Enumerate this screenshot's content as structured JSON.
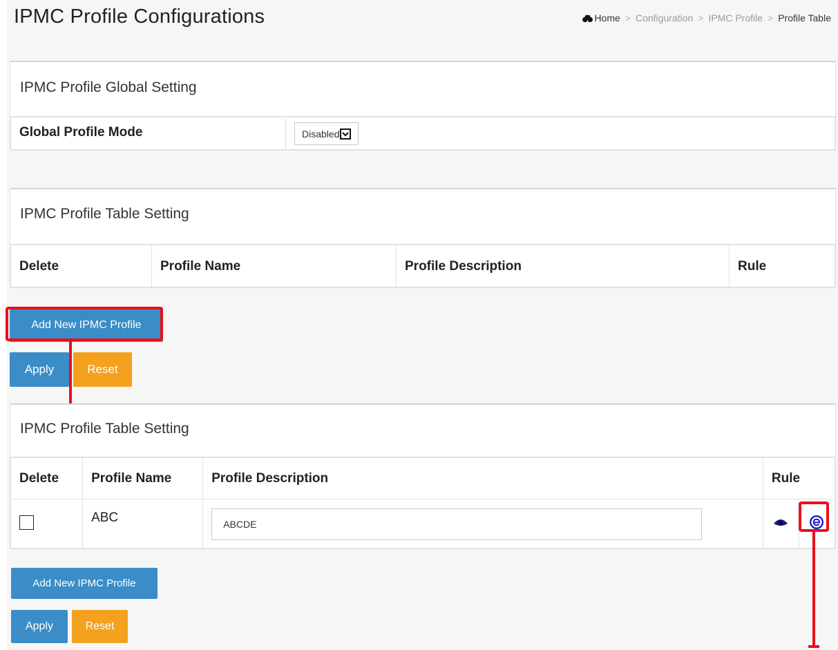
{
  "page": {
    "title": "IPMC Profile Configurations",
    "breadcrumb": [
      "Home",
      "Configuration",
      "IPMC Profile",
      "Profile Table"
    ],
    "breadcrumb_separator": ">"
  },
  "global_panel": {
    "heading": "IPMC Profile Global Setting",
    "mode_label": "Global Profile Mode",
    "mode_value": "Disabled"
  },
  "table_panel_before": {
    "heading": "IPMC Profile Table Setting",
    "columns": [
      "Delete",
      "Profile Name",
      "Profile Description",
      "Rule"
    ],
    "add_button": "Add New IPMC Profile",
    "apply_button": "Apply",
    "reset_button": "Reset"
  },
  "table_panel_after": {
    "heading": "IPMC Profile Table Setting",
    "columns": [
      "Delete",
      "Profile Name",
      "Profile Description",
      "Rule"
    ],
    "rows": [
      {
        "delete_checked": false,
        "profile_name": "ABC",
        "profile_description": "ABCDE"
      }
    ],
    "add_button": "Add New IPMC Profile",
    "apply_button": "Apply",
    "reset_button": "Reset"
  },
  "colors": {
    "primary": "#3a8dc6",
    "warning": "#f4a11e",
    "annotation": "#e8101a",
    "icon_blue": "#1a1acc"
  },
  "icons": [
    "home-icon",
    "view-rule-icon",
    "edit-rule-icon",
    "chevron-down-icon"
  ]
}
